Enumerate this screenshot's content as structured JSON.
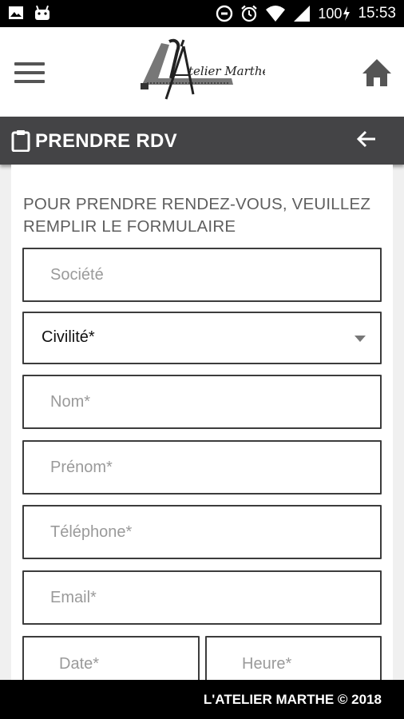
{
  "status_bar": {
    "icons_left": [
      "image-icon",
      "android-icon"
    ],
    "icons_right": [
      "data-saver-icon",
      "alarm-icon",
      "wifi-icon",
      "signal-icon"
    ],
    "battery": "100",
    "time": "15:53"
  },
  "header": {
    "menu_icon": "hamburger-menu-icon",
    "logo_text": "L'Atelier Marthe",
    "home_icon": "home-icon"
  },
  "titlebar": {
    "icon": "clipboard-icon",
    "title": "PRENDRE RDV",
    "back_icon": "arrow-left-icon"
  },
  "form": {
    "intro": "POUR PRENDRE RENDEZ-VOUS, VEUILLEZ REMPLIR LE FORMULAIRE",
    "societe_placeholder": "Société",
    "civilite_value": "Civilité*",
    "nom_placeholder": "Nom*",
    "prenom_placeholder": "Prénom*",
    "telephone_placeholder": "Téléphone*",
    "email_placeholder": "Email*",
    "date_placeholder": "Date*",
    "heure_placeholder": "Heure*"
  },
  "footer": {
    "text": "L'ATELIER MARTHE © 2018"
  },
  "colors": {
    "status_bar": "#000000",
    "titlebar": "#444446",
    "field_border": "#3c3c3c",
    "footer": "#000000"
  }
}
